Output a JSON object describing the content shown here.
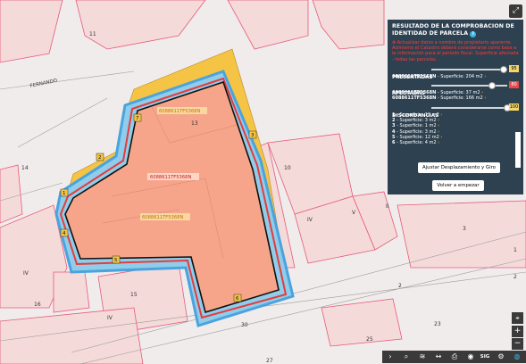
{
  "panel": {
    "title": "RESULTADO DE LA COMPROBACION DE IDENTIDAD DE PARCELA",
    "info_icon": "info-icon",
    "warning": "Actualizar datos a nombre de propietario aparente. Asimismo el Catastro deberá considerarse como base a la información para el periodo fiscal. Superficie afectada - todas las parcelas.",
    "presentadas_label": "PRESENTADAS",
    "presentadas_value": "95",
    "presentadas_fill": 0.95,
    "presentadas_parcel_id": "6088611TF5368N",
    "presentadas_parcel_surface": " - Superficie: 204 m2",
    "afectadas_label": "AFECTADAS",
    "afectadas_value": "80",
    "afectadas_fill": 0.8,
    "afectadas_parcels": [
      {
        "id": "6088611TF5368N",
        "surface": " - Superficie: 37 m2"
      },
      {
        "id": "6088611TF5368N",
        "surface": " - Superficie: 166 m2"
      }
    ],
    "discordancias_label": "DISCORDANCIAS",
    "discordancias_value": "100",
    "discordancias_fill": 1.0,
    "discordancias": [
      {
        "n": "1",
        "text": " - Superficie: 12 m2"
      },
      {
        "n": "2",
        "text": " - Superficie: 3 m2"
      },
      {
        "n": "3",
        "text": " - Superficie: 1 m2"
      },
      {
        "n": "4",
        "text": " - Superficie: 3 m2"
      },
      {
        "n": "5",
        "text": " - Superficie: 12 m2"
      },
      {
        "n": "6",
        "text": " - Superficie: 4 m2"
      }
    ],
    "ajustar_button": "Ajustar Desplazamiento y Giro",
    "volver_button": "Volver a empezar"
  },
  "map": {
    "street_label": "FERNANDO",
    "numbers": [
      "11",
      "14",
      "13",
      "10",
      "V",
      "IV",
      "IV",
      "15",
      "16",
      "30",
      "25",
      "23",
      "27",
      "2",
      "1",
      "2",
      "3",
      "II",
      "IV"
    ],
    "parcel_labels": [
      "6088611TF5368N",
      "6088611TF5368N",
      "6088611TF5368N"
    ],
    "discordance_markers": [
      "1",
      "2",
      "3",
      "4",
      "5",
      "6",
      "7"
    ]
  },
  "controls": {
    "expand_icon": "expand-icon",
    "locate_icon": "locate-icon",
    "zoom_in": "+",
    "zoom_out": "−"
  },
  "toolbar": {
    "icons": [
      "chevron-right-icon",
      "search-icon",
      "layers-icon",
      "measure-icon",
      "print-icon",
      "camera-icon",
      "globe-icon"
    ],
    "sig_label": "SIG"
  },
  "colors": {
    "parcel_fill": "#f6a58a",
    "yellow": "#f5c445",
    "blue": "#4aa3df",
    "red_line": "#e63b3b",
    "panel_bg": "#2e4150",
    "warning": "#ff3b3b",
    "arrow": "#f08a00"
  }
}
